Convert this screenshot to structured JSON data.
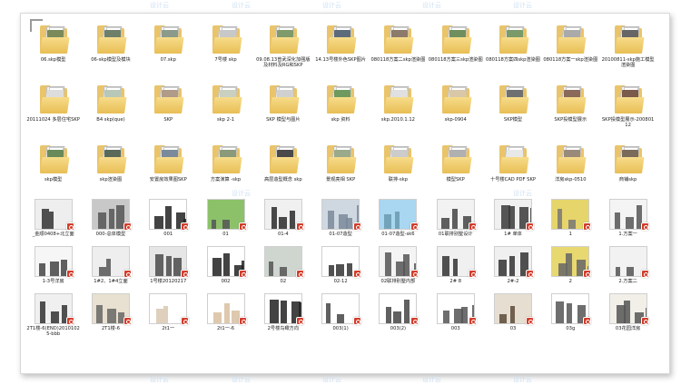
{
  "watermark": "设计云",
  "colors": {
    "folder": "#e9c46a",
    "badge": "#d33d2b",
    "border": "#d8d8d8"
  },
  "items": [
    {
      "type": "folder",
      "label": "06.skp模型",
      "tone": "#7a8a5a"
    },
    {
      "type": "folder",
      "label": "06-skp模型及模块",
      "tone": "#6e7f6a"
    },
    {
      "type": "folder",
      "label": "07.skp",
      "tone": "#8b9a8a"
    },
    {
      "type": "folder",
      "label": "7号楼 skp",
      "tone": "#c8c8c8"
    },
    {
      "type": "folder",
      "label": "09.08.13曾武深化加强版及材料及RG和SKP",
      "tone": "#7f9b6b"
    },
    {
      "type": "folder",
      "label": "14.13号楼外色SKP图片",
      "tone": "#5b6b7b"
    },
    {
      "type": "folder",
      "label": "080118方案二skp渲染图",
      "tone": "#8c7a6a"
    },
    {
      "type": "folder",
      "label": "080118方案三skp渲染图",
      "tone": "#6f8f5f"
    },
    {
      "type": "folder",
      "label": "080118方案四skp渲染图",
      "tone": "#7a9a6a"
    },
    {
      "type": "folder",
      "label": "080118方案一skp渲染图",
      "tone": "#aaaaaa"
    },
    {
      "type": "folder",
      "label": "20100811-skp施工模型渲染图",
      "tone": "#666666"
    },
    {
      "type": "folder",
      "label": "20111024 多层住宅SKP",
      "tone": "#dddddd"
    },
    {
      "type": "folder",
      "label": "B4 skp(que)",
      "tone": "#b8c8b8"
    },
    {
      "type": "folder",
      "label": "SKP",
      "tone": "#b09a88"
    },
    {
      "type": "folder",
      "label": "skp 2-1",
      "tone": "#c9d0c0"
    },
    {
      "type": "folder",
      "label": "SKP 模型与图片",
      "tone": "#d0d0d0"
    },
    {
      "type": "folder",
      "label": "skp 资料",
      "tone": "#6f9a5f"
    },
    {
      "type": "folder",
      "label": "skp.2010.1.12",
      "tone": "#e0e0e0"
    },
    {
      "type": "folder",
      "label": "skp-0904",
      "tone": "#d8c8a8"
    },
    {
      "type": "folder",
      "label": "SKP模型",
      "tone": "#707070"
    },
    {
      "type": "folder",
      "label": "SKP投模型展示",
      "tone": "#8a6a5a"
    },
    {
      "type": "folder",
      "label": "SKP投模型展示-20080112",
      "tone": "#7a5a4a"
    },
    {
      "type": "folder",
      "label": "skp模型",
      "tone": "#6a8a5a"
    },
    {
      "type": "folder",
      "label": "skp渲染图",
      "tone": "#5a6a5a"
    },
    {
      "type": "folder",
      "label": "安置房效果图SKP",
      "tone": "#7a8a9a"
    },
    {
      "type": "folder",
      "label": "方案演算 -skp",
      "tone": "#8a9a7a"
    },
    {
      "type": "folder",
      "label": "高层造型概念 skp",
      "tone": "#4a4a4a"
    },
    {
      "type": "folder",
      "label": "景观亮相 SKP",
      "tone": "#9aaa8a"
    },
    {
      "type": "folder",
      "label": "联排-skp",
      "tone": "#cccccc"
    },
    {
      "type": "folder",
      "label": "模型SKP",
      "tone": "#b0b0b0"
    },
    {
      "type": "folder",
      "label": "十号楼CAD PDF SKP",
      "tone": "#e8e8e8"
    },
    {
      "type": "folder",
      "label": "洋房skp-0510",
      "tone": "#9a8a7a"
    },
    {
      "type": "folder",
      "label": "商铺skp",
      "tone": "#7a6a5a"
    },
    {
      "type": "image",
      "label": "_金顺0408+北立面",
      "bg": "#eeeeee",
      "tone": "#333333"
    },
    {
      "type": "image",
      "label": "000-总体模型",
      "bg": "#c8c8c8",
      "tone": "#555555"
    },
    {
      "type": "image",
      "label": "001",
      "bg": "#ffffff",
      "tone": "#222222"
    },
    {
      "type": "image",
      "label": "01",
      "bg": "#8cc16a",
      "tone": "#555555"
    },
    {
      "type": "image",
      "label": "01-4",
      "bg": "#f0f0f0",
      "tone": "#2a2a2a"
    },
    {
      "type": "image",
      "label": "01-07造型",
      "bg": "#cfd8e0",
      "tone": "#7a8a9a"
    },
    {
      "type": "image",
      "label": "01-07造型-sk6",
      "bg": "#a9d6f0",
      "tone": "#6a9ab0"
    },
    {
      "type": "image",
      "label": "01联排别墅设计",
      "bg": "#f2f2f2",
      "tone": "#444444"
    },
    {
      "type": "image",
      "label": "1# 单体",
      "bg": "#f0f0f0",
      "tone": "#3a3a3a"
    },
    {
      "type": "image",
      "label": "1",
      "bg": "#e6d56a",
      "tone": "#777777"
    },
    {
      "type": "image",
      "label": "1.方案一",
      "bg": "#f4f4f4",
      "tone": "#555555"
    },
    {
      "type": "image",
      "label": "1-3号洋房",
      "bg": "#f6f6f6",
      "tone": "#444444"
    },
    {
      "type": "image",
      "label": "1#2、1#4立面",
      "bg": "#eeeeee",
      "tone": "#555555"
    },
    {
      "type": "image",
      "label": "1号楼20120217",
      "bg": "#e6e6e6",
      "tone": "#4a4a4a"
    },
    {
      "type": "image",
      "label": "002",
      "bg": "#ffffff",
      "tone": "#222222"
    },
    {
      "type": "image",
      "label": "02",
      "bg": "#cfd6cf",
      "tone": "#555555"
    },
    {
      "type": "image",
      "label": "02-12",
      "bg": "#ffffff",
      "tone": "#333333"
    },
    {
      "type": "image",
      "label": "02联排别墅内部",
      "bg": "#f4f4f4",
      "tone": "#555555"
    },
    {
      "type": "image",
      "label": "2# 8",
      "bg": "#f0f0f0",
      "tone": "#333333"
    },
    {
      "type": "image",
      "label": "2#-2",
      "bg": "#f0f0f0",
      "tone": "#333333"
    },
    {
      "type": "image",
      "label": "2",
      "bg": "#e8d870",
      "tone": "#666666"
    },
    {
      "type": "image",
      "label": "2.方案二",
      "bg": "#f2f2f2",
      "tone": "#555555"
    },
    {
      "type": "image",
      "label": "2T1楼-6(END)20101025-bbb",
      "bg": "#f0f0f0",
      "tone": "#333333"
    },
    {
      "type": "image",
      "label": "2T1楼-6",
      "bg": "#e8e0d0",
      "tone": "#666666"
    },
    {
      "type": "image",
      "label": "2t1一",
      "bg": "#ffffff",
      "tone": "#d8c8b0"
    },
    {
      "type": "image",
      "label": "2t1一-6",
      "bg": "#ffffff",
      "tone": "#d8c0a0"
    },
    {
      "type": "image",
      "label": "2号楼鸟瞰方向",
      "bg": "#ffffff",
      "tone": "#222222"
    },
    {
      "type": "image",
      "label": "003(1)",
      "bg": "#ffffff",
      "tone": "#444444"
    },
    {
      "type": "image",
      "label": "003(2)",
      "bg": "#ffffff",
      "tone": "#444444"
    },
    {
      "type": "image",
      "label": "003",
      "bg": "#ffffff",
      "tone": "#555555"
    },
    {
      "type": "image",
      "label": "03",
      "bg": "#e6ded0",
      "tone": "#5a4a3a"
    },
    {
      "type": "image",
      "label": "03g",
      "bg": "#ffffff",
      "tone": "#555555"
    },
    {
      "type": "image",
      "label": "03花园洋房",
      "bg": "#f2efe8",
      "tone": "#555555"
    }
  ]
}
